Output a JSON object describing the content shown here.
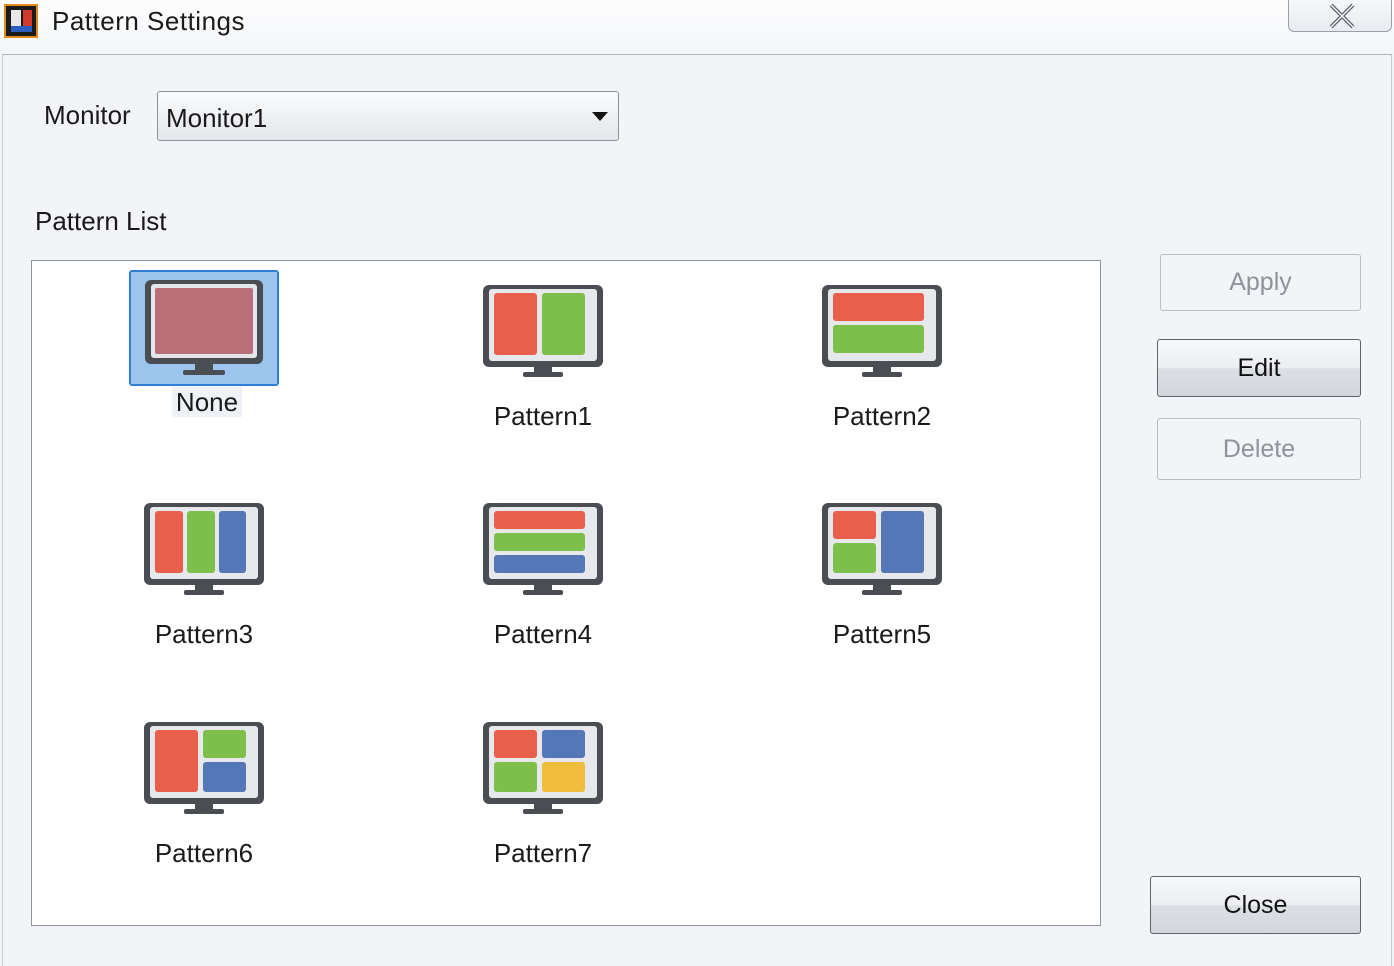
{
  "window": {
    "title": "Pattern Settings",
    "close_icon": "close-icon"
  },
  "monitor": {
    "label": "Monitor",
    "selected": "Monitor1"
  },
  "pattern_list": {
    "label": "Pattern List",
    "items": [
      {
        "label": "None",
        "icon": "monitor-blank-icon",
        "selected": true
      },
      {
        "label": "Pattern1",
        "icon": "monitor-2-columns-icon"
      },
      {
        "label": "Pattern2",
        "icon": "monitor-2-rows-icon"
      },
      {
        "label": "Pattern3",
        "icon": "monitor-3-columns-icon"
      },
      {
        "label": "Pattern4",
        "icon": "monitor-3-rows-icon"
      },
      {
        "label": "Pattern5",
        "icon": "monitor-2-left-1-right-icon"
      },
      {
        "label": "Pattern6",
        "icon": "monitor-1-left-2-right-icon"
      },
      {
        "label": "Pattern7",
        "icon": "monitor-2x2-grid-icon"
      }
    ]
  },
  "buttons": {
    "apply": "Apply",
    "edit": "Edit",
    "delete": "Delete",
    "close": "Close"
  },
  "colors": {
    "red": "#e8604c",
    "green": "#7cbf4a",
    "blue": "#5577b8",
    "yellow": "#f0bc3c",
    "selection_fill": "#9cc5ee",
    "selection_border": "#2f7ed8"
  }
}
